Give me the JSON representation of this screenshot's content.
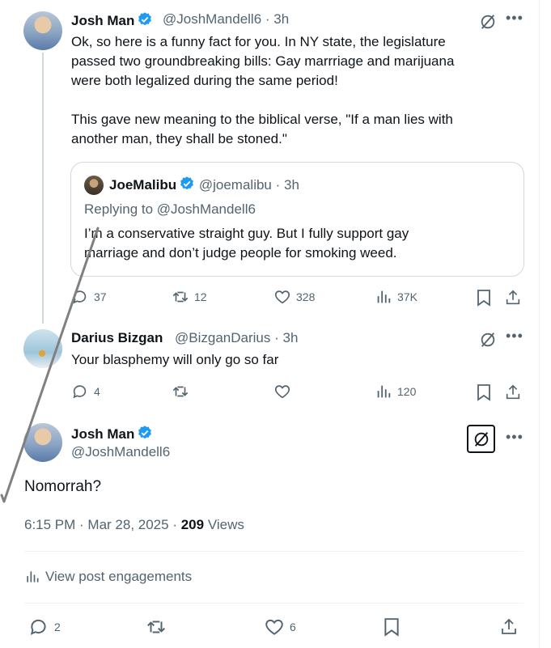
{
  "tweet1": {
    "name": "Josh Man",
    "handle": "@JoshMandell6",
    "time": "· 3h",
    "line1": "Ok, so here is a funny fact for you.   In NY state, the legislature",
    "line2": "passed two groundbreaking bills:  Gay marrriage and marijuana",
    "line3": "were both legalized during the same period!",
    "line4": "This gave new meaning to the biblical verse, \"If a man lies with",
    "line5": "another man, they shall be stoned.\"",
    "quote": {
      "name": "JoeMalibu",
      "handle": "@joemalibu",
      "time": "· 3h",
      "replying": "Replying to @JoshMandell6",
      "line1": "I’m a conservative straight guy. But I fully support gay",
      "line2": "marriage and don’t judge people for smoking weed."
    },
    "replies": "37",
    "reposts": "12",
    "likes": "328",
    "views": "37K"
  },
  "tweet2": {
    "name": "Darius Bizgan",
    "handle": "@BizganDarius",
    "time": "· 3h",
    "text": "Your blasphemy will only go so far",
    "replies": "4",
    "views": "120"
  },
  "tweet3": {
    "name": "Josh Man",
    "handle": "@JoshMandell6",
    "text": "Nomorrah?",
    "timestamp": "6:15 PM · Mar 28, 2025 · ",
    "views_count": "209",
    "views_label": "Views",
    "engagements": "View post engagements",
    "replies": "2",
    "likes": "6"
  },
  "colors": {
    "verified": "#1d9bf0",
    "muted": "#536471",
    "text": "#0f1419",
    "annotation_stroke": "#808080"
  }
}
